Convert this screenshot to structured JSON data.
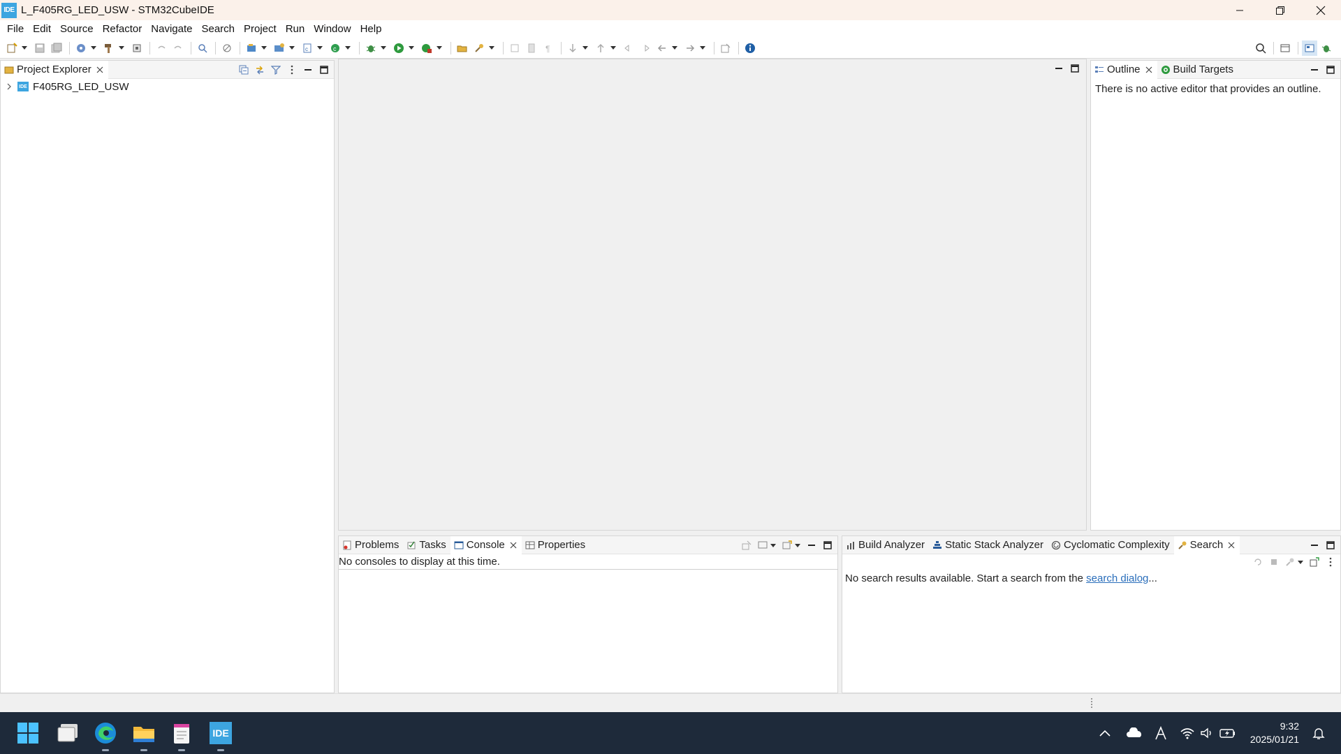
{
  "window": {
    "title": "L_F405RG_LED_USW - STM32CubeIDE",
    "app_icon_text": "IDE"
  },
  "menu": [
    "File",
    "Edit",
    "Source",
    "Refactor",
    "Navigate",
    "Search",
    "Project",
    "Run",
    "Window",
    "Help"
  ],
  "project_explorer": {
    "tab": "Project Explorer",
    "tree": [
      {
        "label": "F405RG_LED_USW",
        "icon_text": "IDE"
      }
    ]
  },
  "outline": {
    "tabs": [
      "Outline",
      "Build Targets"
    ],
    "message": "There is no active editor that provides an outline."
  },
  "bottom_left": {
    "tabs": [
      "Problems",
      "Tasks",
      "Console",
      "Properties"
    ],
    "active": "Console",
    "message": "No consoles to display at this time."
  },
  "bottom_right": {
    "tabs": [
      "Build Analyzer",
      "Static Stack Analyzer",
      "Cyclomatic Complexity",
      "Search"
    ],
    "active": "Search",
    "message_prefix": "No search results available. Start a search from the ",
    "link": "search dialog",
    "message_suffix": "..."
  },
  "taskbar": {
    "pinned": [
      "windows-start",
      "task-view",
      "edge",
      "file-explorer",
      "notepad",
      "stm32cubeide"
    ],
    "ide_icon_text": "IDE",
    "time": "9:32",
    "date": "2025/01/21"
  },
  "colors": {
    "titlebar": "#fbf1ea",
    "taskbar": "#1e2a3a",
    "accent": "#3da5e0",
    "link": "#2a6ebb"
  }
}
